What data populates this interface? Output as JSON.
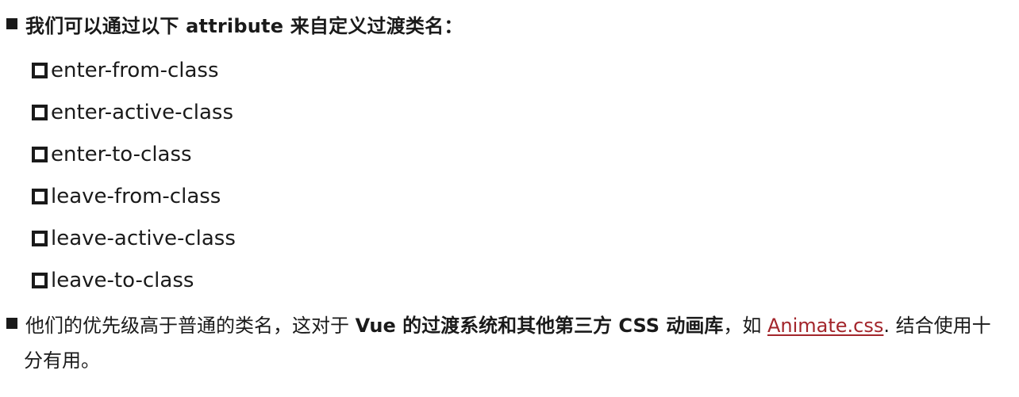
{
  "heading": {
    "text": "我们可以通过以下 attribute 来自定义过渡类名："
  },
  "class_list": [
    "enter-from-class",
    "enter-active-class",
    "enter-to-class",
    "leave-from-class",
    "leave-active-class",
    "leave-to-class"
  ],
  "paragraph": {
    "part1": "他们的优先级高于普通的类名，这对于 ",
    "part2_bold": "Vue 的过渡系统和其他第三方 CSS 动画库",
    "part3": "，如 ",
    "link_text": "Animate.css",
    "part4": ". 结合使用十",
    "line2": "分有用。"
  },
  "colors": {
    "text": "#1a1a1a",
    "link": "#a3252b",
    "background": "#ffffff"
  },
  "icons": {
    "heading_bullet": "filled-square-bullet",
    "list_bullet": "hollow-square-bullet"
  }
}
